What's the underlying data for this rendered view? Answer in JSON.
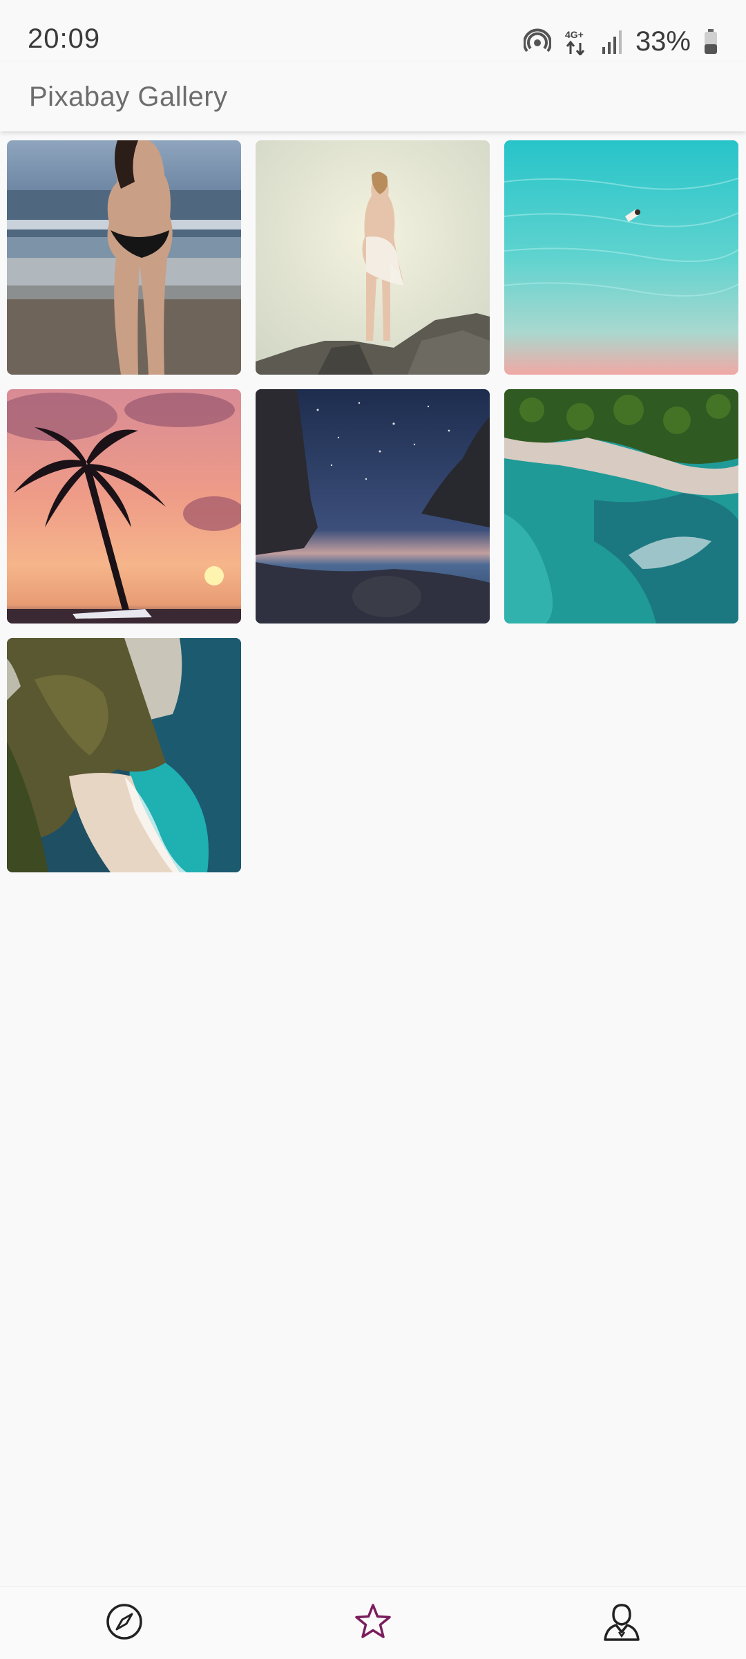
{
  "status": {
    "time": "20:09",
    "network": "4G+",
    "battery_percent": "33%"
  },
  "app": {
    "title": "Pixabay Gallery"
  },
  "gallery": {
    "images": [
      {
        "subject": "woman-in-bikini-on-beach"
      },
      {
        "subject": "woman-on-rocks-bright-sky"
      },
      {
        "subject": "aerial-turquoise-water-swimmer"
      },
      {
        "subject": "palm-tree-sunset"
      },
      {
        "subject": "starry-night-cove"
      },
      {
        "subject": "aerial-coast-forest-sea"
      },
      {
        "subject": "cliff-beach-turquoise-sea"
      }
    ]
  },
  "nav": {
    "items": [
      {
        "icon": "compass-icon",
        "active": false
      },
      {
        "icon": "star-icon",
        "active": true
      },
      {
        "icon": "profile-icon",
        "active": false
      }
    ],
    "active_color": "#7b1d5c",
    "inactive_color": "#222222"
  }
}
